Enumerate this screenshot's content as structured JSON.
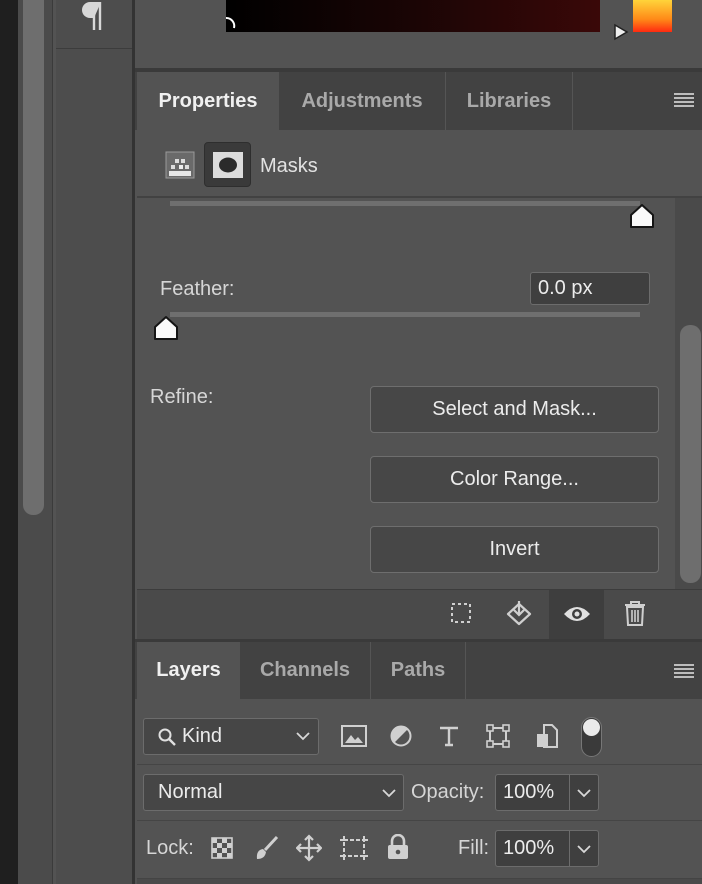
{
  "properties_panel": {
    "tabs": [
      {
        "label": "Properties"
      },
      {
        "label": "Adjustments"
      },
      {
        "label": "Libraries"
      }
    ],
    "section_label": "Masks",
    "feather": {
      "label": "Feather:",
      "value": "0.0 px",
      "level": 0
    },
    "density": {
      "level": 100
    },
    "refine": {
      "label": "Refine:",
      "buttons": [
        {
          "label": "Select and Mask..."
        },
        {
          "label": "Color Range..."
        },
        {
          "label": "Invert"
        }
      ]
    }
  },
  "layers_panel": {
    "tabs": [
      {
        "label": "Layers"
      },
      {
        "label": "Channels"
      },
      {
        "label": "Paths"
      }
    ],
    "filter": {
      "selected": "Kind"
    },
    "blend_mode": {
      "selected": "Normal"
    },
    "opacity": {
      "label": "Opacity:",
      "value": "100%"
    },
    "lock": {
      "label": "Lock:"
    },
    "fill": {
      "label": "Fill:",
      "value": "100%"
    }
  },
  "colors": {
    "panel_bg": "#535353",
    "tab_bar_bg": "#424242",
    "button_bg": "#474747",
    "field_bg": "#3f3f3f"
  }
}
